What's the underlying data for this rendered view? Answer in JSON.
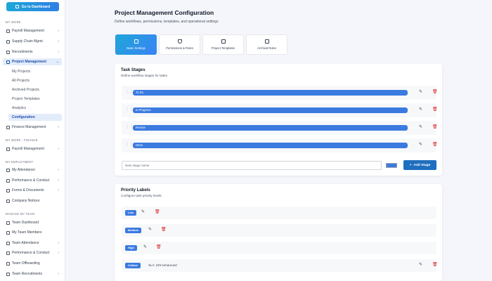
{
  "sidebar": {
    "dashboard_button": "Go to Dashboard",
    "sections": {
      "my_work": "MY WORK",
      "my_work_finance": "MY WORK - FINANCE",
      "my_employment": "MY EMPLOYMENT",
      "manage_team": "MANAGE MY TEAM"
    },
    "items": {
      "payroll": "Payroll Management",
      "supply": "Supply Chain Mgmt.",
      "recruitments": "Recruitments",
      "project_mgmt": "Project Management",
      "my_projects": "My Projects",
      "all_projects": "All Projects",
      "archived": "Archived Projects",
      "templates": "Project Templates",
      "analytics": "Analytics",
      "configuration": "Configuration",
      "finance": "Finance Management",
      "payroll2": "Payroll Management",
      "attendance": "My Attendance",
      "performance": "Performance & Conduct",
      "forms": "Forms & Documents",
      "notices": "Company Notices",
      "team_dashboard": "Team Dashboard",
      "team_members": "My Team Members",
      "team_attendance": "Team Attendance",
      "team_performance": "Performance & Conduct",
      "team_offboarding": "Team Offboarding",
      "team_recruitments": "Team Recruitments"
    }
  },
  "header": {
    "title": "Project Management Configuration",
    "subtitle": "Define workflows, permissions, templates, and operational settings"
  },
  "tabs": [
    "Basic Settings",
    "Permissions & Roles",
    "Project Templates",
    "Archival Rules"
  ],
  "task_stages": {
    "title": "Task Stages",
    "description": "Define workflow stages for tasks",
    "stages": [
      "To Do",
      "In Progress",
      "Review",
      "Done"
    ],
    "stage_color": "#3b7be0",
    "new_placeholder": "New stage name",
    "add_button": "Add Stage"
  },
  "priority_labels": {
    "title": "Priority Labels",
    "description": "Configure task priority levels",
    "labels": [
      {
        "name": "Low",
        "desc": ""
      },
      {
        "name": "Medium",
        "desc": ""
      },
      {
        "name": "High",
        "desc": ""
      },
      {
        "name": "Critical",
        "desc": "SLA: 24h turnaround"
      }
    ]
  },
  "icons": {
    "drag": "drag-handle-icon",
    "edit": "pencil-icon",
    "delete": "trash-icon"
  }
}
